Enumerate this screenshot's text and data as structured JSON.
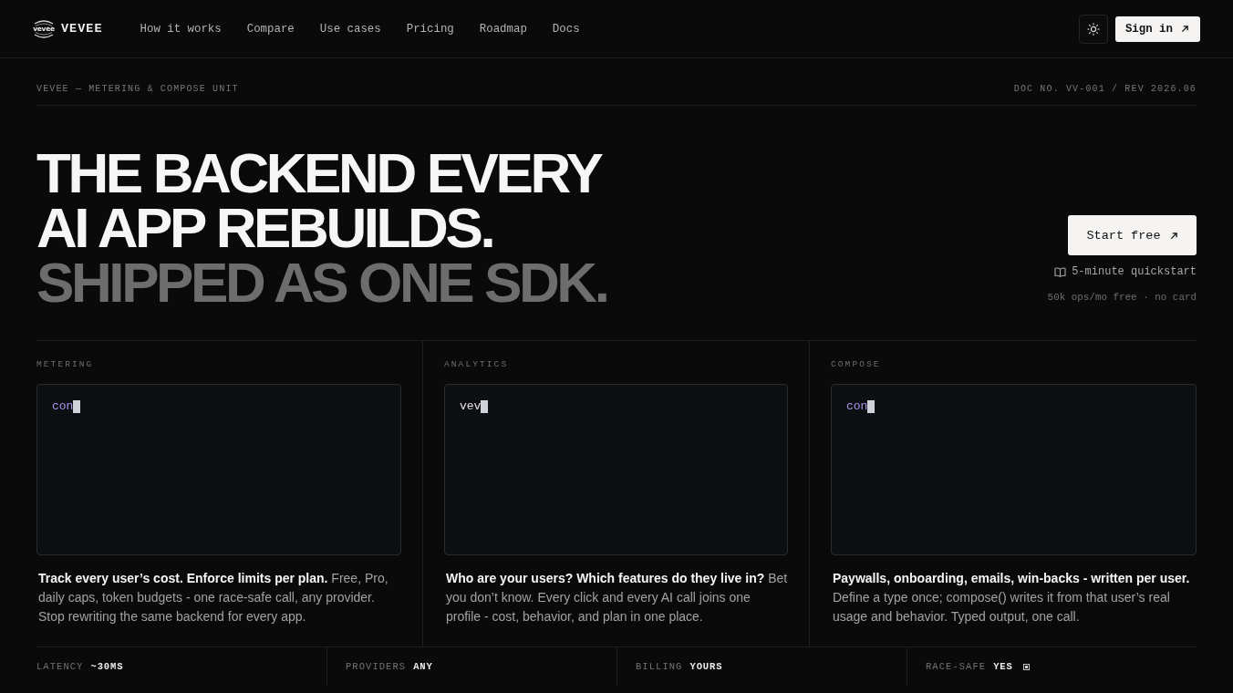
{
  "nav": {
    "logo_mark": "vevee",
    "brand": "VEVEE",
    "links": [
      "How it works",
      "Compare",
      "Use cases",
      "Pricing",
      "Roadmap",
      "Docs"
    ],
    "sign_in": "Sign in"
  },
  "doc_header": {
    "left": "VEVEE — METERING & COMPOSE UNIT",
    "right": "DOC NO. VV-001 / REV 2026.06"
  },
  "hero": {
    "lines": [
      {
        "text": "THE BACKEND EVERY",
        "muted": false
      },
      {
        "text": "AI APP REBUILDS.",
        "muted": false
      },
      {
        "text": "SHIPPED AS ONE SDK.",
        "muted": true
      }
    ],
    "cta": "Start free",
    "quickstart": "5-minute quickstart",
    "note": "50k ops/mo free · no card"
  },
  "columns": [
    {
      "label": "METERING",
      "code": {
        "text": "con",
        "kind": "keyword"
      },
      "description": "**Track every user’s cost. Enforce limits per plan.** Free, Pro, daily caps, token budgets - one race-safe call, any provider. Stop rewriting the same backend for every app."
    },
    {
      "label": "ANALYTICS",
      "code": {
        "text": "vev",
        "kind": "plain"
      },
      "description": "**Who are your users? Which features do they live in?** Bet you don’t know. Every click and every AI call joins one profile - cost, behavior, and plan in one place."
    },
    {
      "label": "COMPOSE",
      "code": {
        "text": "con",
        "kind": "keyword"
      },
      "description": "**Paywalls, onboarding, emails, win-backs - written per user.** Define a type once; compose() writes it from that user’s real usage and behavior. Typed output, one call."
    }
  ],
  "stats": [
    {
      "label": "LATENCY",
      "value": "~30MS",
      "marked": false
    },
    {
      "label": "PROVIDERS",
      "value": "ANY",
      "marked": false
    },
    {
      "label": "BILLING",
      "value": "YOURS",
      "marked": false
    },
    {
      "label": "RACE-SAFE",
      "value": "YES",
      "marked": true
    }
  ]
}
